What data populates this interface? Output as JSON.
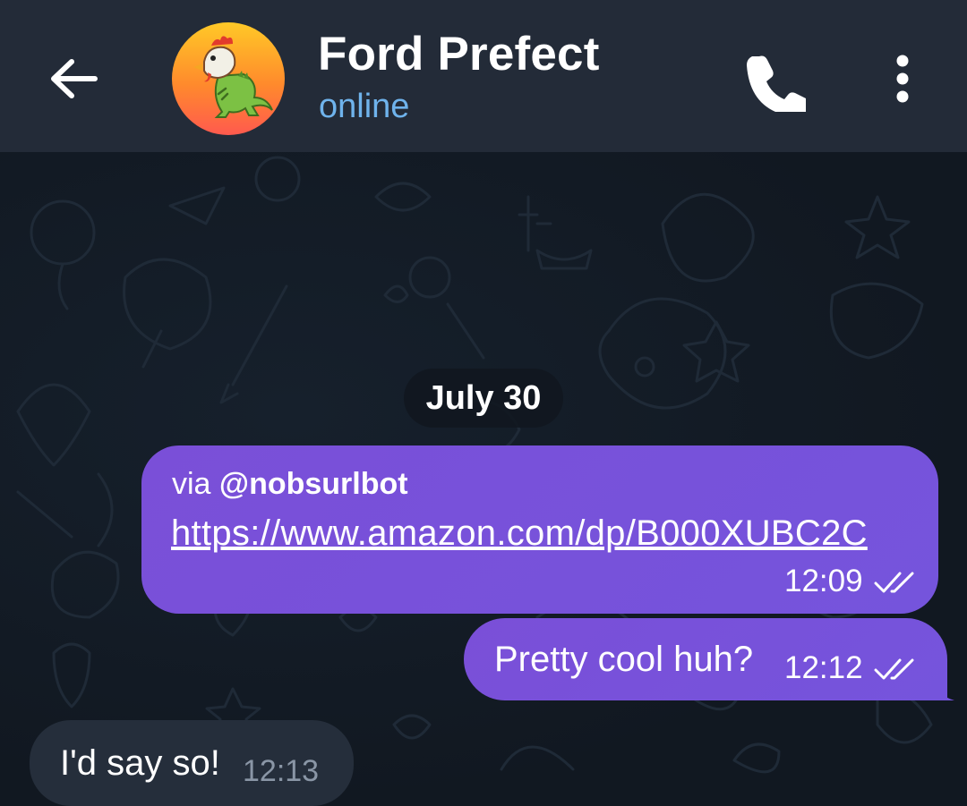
{
  "header": {
    "contact_name": "Ford Prefect",
    "status": "online",
    "icons": [
      "back-arrow-icon",
      "dinosaur-avatar",
      "phone-icon",
      "more-vertical-icon"
    ]
  },
  "chat": {
    "date_separator": "July 30",
    "messages": [
      {
        "direction": "outgoing",
        "via_prefix": "via ",
        "via_bot": "@nobsurlbot",
        "link": "https://www.amazon.com/dp/B000XUBC2C",
        "time": "12:09",
        "read": true
      },
      {
        "direction": "outgoing",
        "text": "Pretty cool huh?",
        "time": "12:12",
        "read": true
      },
      {
        "direction": "incoming",
        "text": "I'd say so!",
        "time": "12:13"
      }
    ]
  },
  "colors": {
    "header_bg": "#232b38",
    "chat_bg": "#121a24",
    "outgoing_bubble": "#7554dc",
    "incoming_bubble": "#252e3b",
    "status_blue": "#6fb3ec"
  }
}
